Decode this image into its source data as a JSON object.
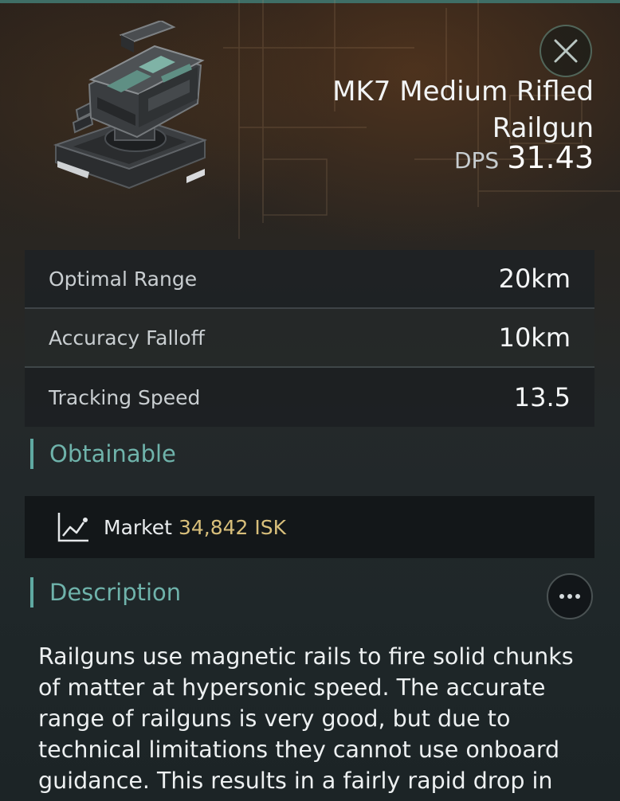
{
  "item": {
    "title": "MK7 Medium Rifled Railgun",
    "dps_label": "DPS",
    "dps_value": "31.43"
  },
  "icons": {
    "close": "close-icon",
    "market": "market-chart-icon",
    "more": "more-options-icon"
  },
  "stats": [
    {
      "label": "Optimal Range",
      "value": "20km"
    },
    {
      "label": "Accuracy Falloff",
      "value": "10km"
    },
    {
      "label": "Tracking Speed",
      "value": "13.5"
    }
  ],
  "obtainable": {
    "title": "Obtainable",
    "market_label": "Market",
    "market_price": "34,842 ISK"
  },
  "description": {
    "title": "Description",
    "text": "Railguns use magnetic rails to fire solid chunks\n of matter at hypersonic speed. The accurate\nrange of railguns is very good, but due to\ntechnical limitations they cannot use onboard\nguidance. This results in a fairly rapid drop in"
  },
  "colors": {
    "accent": "#6fb3ab",
    "price": "#d8bf7b",
    "top_bar": "#3f6e66"
  }
}
